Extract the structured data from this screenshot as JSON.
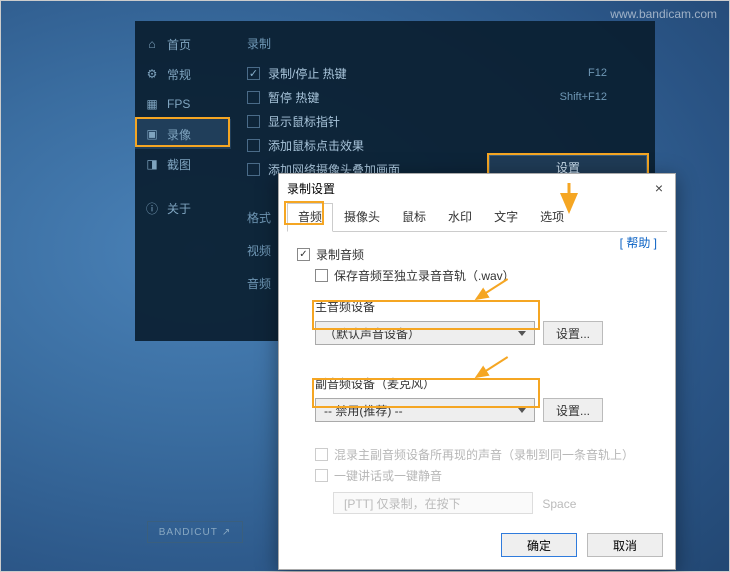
{
  "watermark": "www.bandicam.com",
  "app": {
    "sidebar": {
      "items": [
        {
          "label": "首页",
          "icon": "home-icon"
        },
        {
          "label": "常规",
          "icon": "gear-icon"
        },
        {
          "label": "FPS",
          "icon": "fps-icon"
        },
        {
          "label": "录像",
          "icon": "video-icon",
          "active": true
        },
        {
          "label": "截图",
          "icon": "camera-icon"
        },
        {
          "label": "关于",
          "icon": "info-icon"
        }
      ]
    },
    "section_heading": "录制",
    "rows": [
      {
        "label": "录制/停止 热键",
        "checked": true,
        "hotkey": "F12"
      },
      {
        "label": "暂停 热键",
        "checked": false,
        "hotkey": "Shift+F12"
      },
      {
        "label": "显示鼠标指针",
        "checked": false
      },
      {
        "label": "添加鼠标点击效果",
        "checked": false
      },
      {
        "label": "添加网络摄像头叠加画面",
        "checked": false
      }
    ],
    "settings_button": "设置",
    "left_labels": {
      "format": "格式",
      "video": "视频",
      "audio": "音频"
    },
    "bandicut": "BANDICUT"
  },
  "dialog": {
    "title": "录制设置",
    "close": "×",
    "tabs": [
      "音频",
      "摄像头",
      "鼠标",
      "水印",
      "文字",
      "选项"
    ],
    "active_tab": 0,
    "help": "[ 帮助 ]",
    "record_audio": {
      "label": "录制音频",
      "checked": true
    },
    "save_wav": {
      "label": "保存音频至独立录音音轨（.wav）",
      "checked": false
    },
    "primary": {
      "label": "主音频设备",
      "select": "（默认声音设备）",
      "config": "设置..."
    },
    "secondary": {
      "label": "副音频设备（麦克风）",
      "select": "-- 禁用(推荐) --",
      "config": "设置..."
    },
    "mix": {
      "label": "混录主副音频设备所再现的声音（录制到同一条音轨上）",
      "checked": false,
      "disabled": true
    },
    "ptt_ck": {
      "label": "一键讲话或一键静音",
      "checked": false,
      "disabled": true
    },
    "ptt_field": "[PTT] 仅录制，在按下",
    "ptt_key": "Space",
    "ok": "确定",
    "cancel": "取消"
  },
  "colors": {
    "highlight": "#f5a623"
  }
}
